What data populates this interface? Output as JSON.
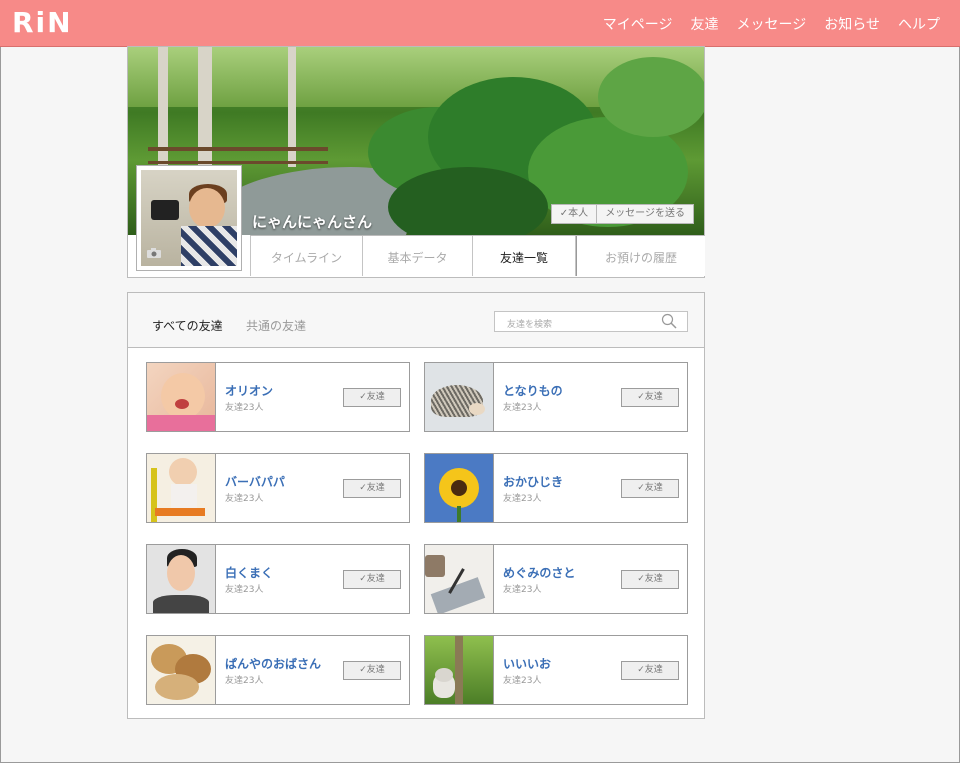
{
  "header": {
    "logo": "RiN",
    "nav": [
      "マイページ",
      "友達",
      "メッセージ",
      "お知らせ",
      "ヘルプ"
    ]
  },
  "profile": {
    "name": "にゃんにゃんさん",
    "friend_button": "✓本人",
    "message_button": "メッセージを送る",
    "tabs": [
      "タイムライン",
      "基本データ",
      "友達一覧",
      "お預けの履歴"
    ],
    "active_tab": "友達一覧"
  },
  "friends": {
    "tab_all": "すべての友達",
    "tab_common": "共通の友達",
    "search_placeholder": "友達を検索",
    "list": [
      {
        "name": "オリオン",
        "count": "友達23人",
        "badge": "✓友達",
        "image": "baby-eating"
      },
      {
        "name": "となりもの",
        "count": "友達23人",
        "badge": "✓友達",
        "image": "hedgehog"
      },
      {
        "name": "バーバパパ",
        "count": "友達23人",
        "badge": "✓友達",
        "image": "baby-toy"
      },
      {
        "name": "おかひじき",
        "count": "友達23人",
        "badge": "✓友達",
        "image": "sunflower"
      },
      {
        "name": "白くまく",
        "count": "友達23人",
        "badge": "✓友達",
        "image": "woman-portrait"
      },
      {
        "name": "めぐみのさと",
        "count": "友達23人",
        "badge": "✓友達",
        "image": "writing-hand"
      },
      {
        "name": "ぱんやのおばさん",
        "count": "友達23人",
        "badge": "✓友達",
        "image": "bread"
      },
      {
        "name": "いいいお",
        "count": "友達23人",
        "badge": "✓友達",
        "image": "kitten"
      }
    ]
  },
  "colors": {
    "header_bg": "#f78a88",
    "link_blue": "#3b6fb6"
  }
}
